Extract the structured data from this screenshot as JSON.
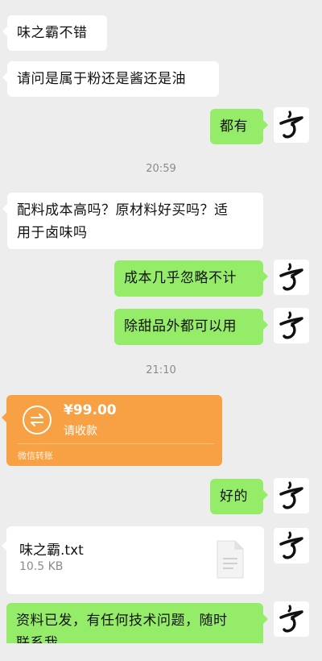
{
  "messages": {
    "m1": "味之霸不错",
    "m2": "请问是属于粉还是酱还是油",
    "m3": "都有",
    "m4_line1": "配料成本高吗？原材料好买吗？适",
    "m4_line2": "用于卤味吗",
    "m5": "成本几乎忽略不计",
    "m6": "除甜品外都可以用",
    "m7": "好的",
    "m8_line1": "资料已发，有任何技术问题，随时",
    "m8_line2": "联系我"
  },
  "times": {
    "t1": "20:59",
    "t2": "21:10"
  },
  "transfer": {
    "amount": "¥99.00",
    "status": "请收款",
    "footer": "微信转账",
    "color": "#f8a144"
  },
  "file": {
    "name": "味之霸.txt",
    "size": "10.5 KB"
  },
  "colors": {
    "background": "#ededed",
    "sent_bubble": "#95ec69",
    "received_bubble": "#ffffff"
  },
  "avatar_icon": "calligraphy-avatar-icon"
}
